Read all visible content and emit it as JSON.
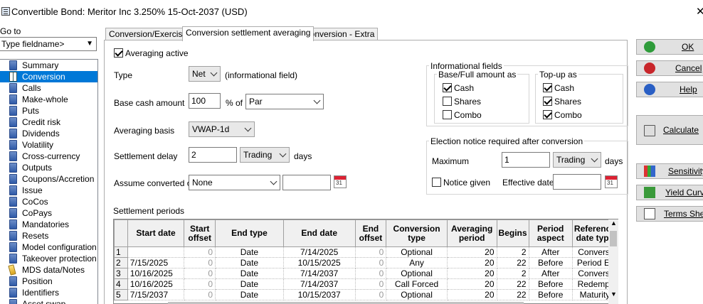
{
  "window": {
    "title": "Convertible Bond: Meritor Inc 3.250% 15-Oct-2037 (USD)"
  },
  "left_panel": {
    "goto_label": "Go to",
    "field_select": "Type fieldname>",
    "items": [
      {
        "label": "Summary"
      },
      {
        "label": "Conversion"
      },
      {
        "label": "Calls"
      },
      {
        "label": "Make-whole"
      },
      {
        "label": "Puts"
      },
      {
        "label": "Credit risk"
      },
      {
        "label": "Dividends"
      },
      {
        "label": "Volatility"
      },
      {
        "label": "Cross-currency"
      },
      {
        "label": "Outputs"
      },
      {
        "label": "Coupons/Accretion"
      },
      {
        "label": "Issue"
      },
      {
        "label": "CoCos"
      },
      {
        "label": "CoPays"
      },
      {
        "label": "Mandatories"
      },
      {
        "label": "Resets"
      },
      {
        "label": "Model configuration"
      },
      {
        "label": "Takeover protection"
      },
      {
        "label": "MDS data/Notes"
      },
      {
        "label": "Position"
      },
      {
        "label": "Identifiers"
      },
      {
        "label": "Asset swap"
      }
    ]
  },
  "tabs": [
    {
      "label": "Conversion/Exercise"
    },
    {
      "label": "Conversion settlement averaging"
    },
    {
      "label": "Conversion - Extra"
    }
  ],
  "form": {
    "averaging_active": "Averaging active",
    "type_label": "Type",
    "type_value": "Net",
    "type_note": "(informational field)",
    "base_cash_label": "Base cash amount",
    "base_cash_value": "100",
    "pct_of": "% of",
    "base_of_value": "Par",
    "averaging_basis_label": "Averaging basis",
    "averaging_basis_value": "VWAP-1d",
    "settlement_delay_label": "Settlement delay",
    "settlement_delay_value": "2",
    "settlement_delay_unit": "Trading",
    "days": "days",
    "assume_converted_label": "Assume converted on",
    "assume_converted_value": "None",
    "settlement_periods_label": "Settlement periods"
  },
  "info": {
    "title": "Informational fields",
    "base_full_title": "Base/Full amount as",
    "topup_title": "Top-up as",
    "cash": "Cash",
    "shares": "Shares",
    "combo": "Combo"
  },
  "election": {
    "title": "Election notice required after conversion",
    "maximum_label": "Maximum",
    "maximum_value": "1",
    "maximum_unit": "Trading",
    "days": "days",
    "notice_given": "Notice given",
    "effective_date_label": "Effective date"
  },
  "table": {
    "headers": [
      "",
      "Start date",
      "Start offset",
      "End type",
      "End date",
      "End offset",
      "Conversion type",
      "Averaging period",
      "Begins",
      "Period aspect",
      "Reference date type"
    ],
    "rows": [
      [
        "1",
        "",
        "0",
        "Date",
        "7/14/2025",
        "0",
        "Optional",
        "20",
        "2",
        "After",
        "Conversi"
      ],
      [
        "2",
        "7/15/2025",
        "0",
        "Date",
        "10/15/2025",
        "0",
        "Any",
        "20",
        "22",
        "Before",
        "Period Er"
      ],
      [
        "3",
        "10/16/2025",
        "0",
        "Date",
        "7/14/2037",
        "0",
        "Optional",
        "20",
        "2",
        "After",
        "Conversi"
      ],
      [
        "4",
        "10/16/2025",
        "0",
        "Date",
        "7/14/2037",
        "0",
        "Call Forced",
        "20",
        "22",
        "Before",
        "Redempt"
      ],
      [
        "5",
        "7/15/2037",
        "0",
        "Date",
        "10/15/2037",
        "0",
        "Optional",
        "20",
        "22",
        "Before",
        "Maturity"
      ]
    ]
  },
  "buttons": {
    "ok": "OK",
    "cancel": "Cancel",
    "help": "Help",
    "calculate": "Calculate",
    "sensitivity": "Sensitivity...",
    "yield_curve": "Yield Curve",
    "terms_sheet": "Terms Sheet"
  }
}
